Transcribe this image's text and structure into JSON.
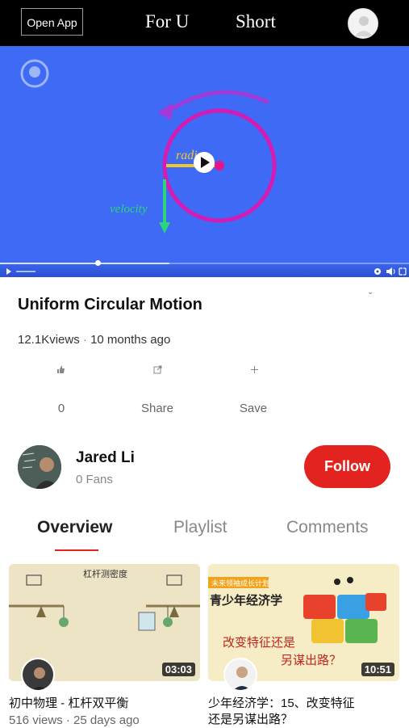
{
  "topbar": {
    "open_app": "Open App",
    "tabs": [
      "For U",
      "Short"
    ]
  },
  "video": {
    "overlay_labels": {
      "radius": "radius",
      "velocity": "velocity"
    },
    "progress": 0.41
  },
  "info": {
    "title": "Uniform Circular Motion",
    "views": "12.1Kviews",
    "time": "10 months ago",
    "actions": [
      {
        "icon": "thumbs-up-icon",
        "label": "0"
      },
      {
        "icon": "share-icon",
        "label": "Share"
      },
      {
        "icon": "plus-icon",
        "label": "Save"
      }
    ]
  },
  "channel": {
    "name": "Jared Li",
    "fans": "0 Fans",
    "follow_label": "Follow"
  },
  "tabs": [
    "Overview",
    "Playlist",
    "Comments"
  ],
  "active_tab": "Overview",
  "cards": [
    {
      "thumb_text": "杠杆测密度",
      "duration": "03:03",
      "title": "初中物理 - 杠杆双平衡",
      "meta": "516 views · 25 days ago"
    },
    {
      "thumb_banner": "未来领袖成长计划",
      "thumb_heading": "青少年经济学",
      "thumb_text_1": "改变特征还是",
      "thumb_text_2": "另谋出路？",
      "duration": "10:51",
      "title_1": "少年经济学：15、改变特征",
      "title_2": "还是另谋出路？"
    }
  ],
  "colors": {
    "accent": "#e3231f",
    "player_bg": "#3f6af5"
  }
}
